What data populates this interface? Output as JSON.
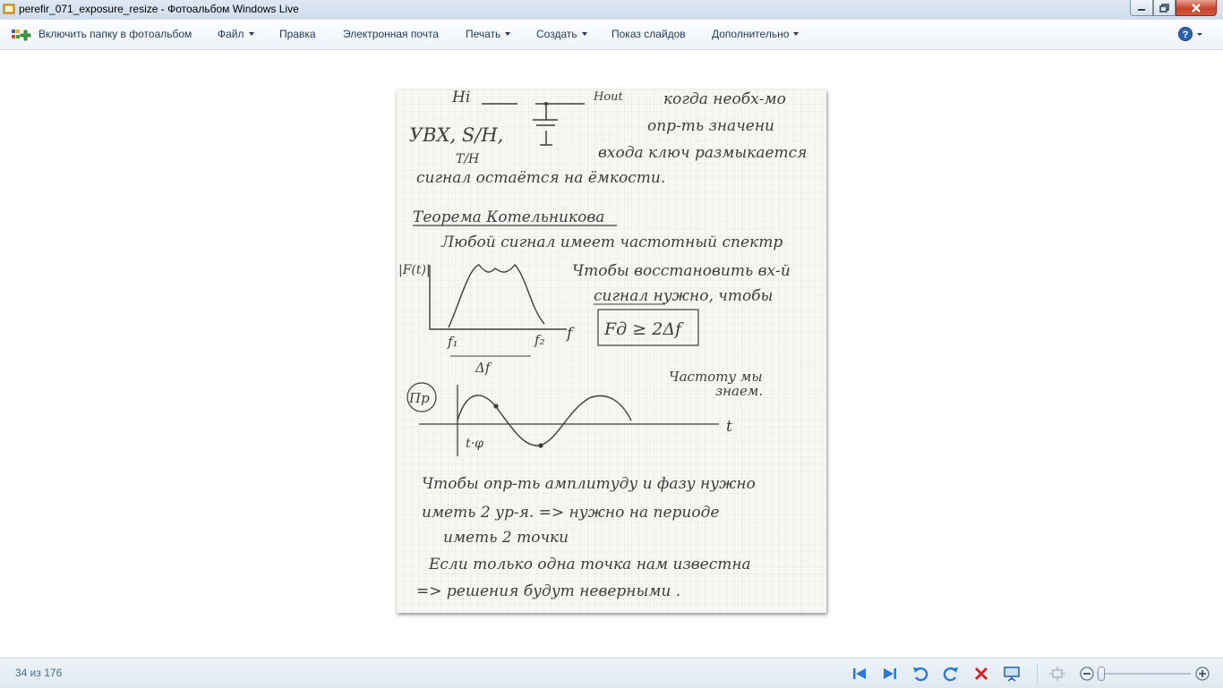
{
  "window": {
    "title": "perefir_071_exposure_resize - Фотоальбом Windows Live"
  },
  "menu": {
    "include_folder": "Включить папку в фотоальбом",
    "file": "Файл",
    "edit": "Правка",
    "email": "Электронная почта",
    "print": "Печать",
    "create": "Создать",
    "slideshow": "Показ слайдов",
    "more": "Дополнительно"
  },
  "photo": {
    "notes": {
      "line1": "Hi",
      "line1b": "Hout",
      "line1c": "когда необх-мо",
      "line2": "опр-ть значени",
      "line3": "УВХ, S/H,",
      "line3b": "входа ключ размыкается",
      "line4": "T/H",
      "line5": "сигнал остаётся на ёмкости.",
      "heading": "Теорема Котельникова",
      "line6": "Любой сигнал имеет частотный спектр",
      "fig_label": "|F(t)|",
      "line7": "Чтобы восстановить вх-й",
      "line8": "сигнал нужно, чтобы",
      "formula": "Fд ≥ 2Δf",
      "f1": "f₁",
      "f2": "f₂",
      "f_axis": "f",
      "delta_f": "Δf",
      "side1": "Частоту мы",
      "side2": "знаем.",
      "ex_label": "Пр",
      "t_axis": "t",
      "t_phi": "t·φ",
      "line9": "Чтобы опр-ть амплитуду и фазу нужно",
      "line10": "иметь 2 ур-я. => нужно на периоде",
      "line11": "иметь 2 точки",
      "line12": "Если только одна точка нам известна",
      "line13": "=> решения будут неверными ."
    }
  },
  "status": {
    "counter": "34 из 176"
  },
  "colors": {
    "menu_text": "#1e395b",
    "control_blue": "#2a7ad5",
    "delete_red": "#d42020"
  }
}
